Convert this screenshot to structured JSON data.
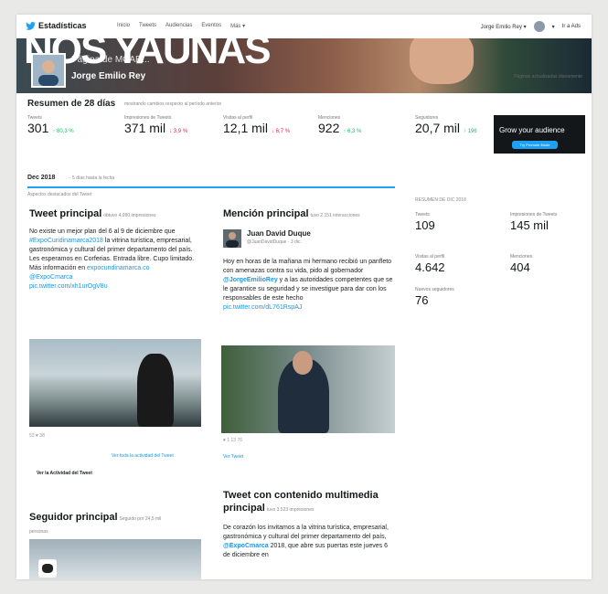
{
  "nav": {
    "brand": "Estadísticas",
    "links": [
      "Inicio",
      "Tweets",
      "Audiencias",
      "Eventos",
      "Más ▾"
    ],
    "account": "Jorge Emilio Rey ▾",
    "ads": "Ir a Ads"
  },
  "banner": {
    "big_text": "NOS YAUNAS",
    "overlay_text": "Página de MCAR...",
    "name": "Jorge Emilio Rey",
    "handle": "@JorgeEmilioRey",
    "right_note": "Páginas actualizadas diariamente"
  },
  "summary": {
    "title": "Resumen de 28 días",
    "subtitle": "mostrando cambios respecto al período anterior",
    "metrics": [
      {
        "label": "Tweets",
        "value": "301",
        "change": "↑ 80,3 %",
        "dir": "up"
      },
      {
        "label": "Impresiones de Tweets",
        "value": "371 mil",
        "change": "↓ 3,9 %",
        "dir": "down"
      },
      {
        "label": "Visitas al perfil",
        "value": "12,1 mil",
        "change": "↓ 6,7 %",
        "dir": "down"
      },
      {
        "label": "Menciones",
        "value": "922",
        "change": "↑ 6,3 %",
        "dir": "up"
      },
      {
        "label": "Seguidores",
        "value": "20,7 mil",
        "change": "↑ 196",
        "dir": "up"
      }
    ],
    "promo_title": "Grow your audience",
    "promo_button": "Try Promote Mode"
  },
  "month": {
    "label": "Dec 2018",
    "subtitle": "· 5 días hasta la fecha",
    "note": "Aspectos destacados del Tweet"
  },
  "top_tweet": {
    "title": "Tweet principal",
    "sub": "obtuvo 4.990 impresiones",
    "text_1": "No existe un mejor plan del 6 al 9 de diciembre que ",
    "hashtag": "#ExpoCundinamarca2018",
    "text_2": " la vitrina turística, empresarial, gastronómica y cultural del primer departamento del país. Les esperamos en Corferias. Entrada libre. Cupo limitado. Más información en ",
    "url_1": "expocundinamarca.co",
    "mention": "@ExpoCmarca",
    "pic": "pic.twitter.com/xh1urOgV8u",
    "stats": "53  ♥ 38",
    "view_activity": "Ver toda la actividad del Tweet",
    "view_label": "Ver la Actividad del Tweet"
  },
  "top_mention": {
    "title": "Mención principal",
    "sub": "tuvo 2.151 interacciones",
    "user": "Juan David Duque",
    "user_handle": "@JuanDavidDuque · 3 dic.",
    "text_1": "Hoy en horas de la mañana mi hermano recibió un panfleto con amenazas contra su vida, pido al gobernador ",
    "mention_1": "@JorgeEmilioRey",
    "text_2": " y a las autoridades competentes que se le garantice su seguridad y se investigue para dar con los responsables de este hecho ",
    "pic": "pic.twitter.com/dL761RspAJ",
    "stats": "♥ 1  13  76",
    "view": "Ver Tweet"
  },
  "media_tweet": {
    "title": "Tweet con contenido multimedia principal",
    "sub": "tuvo 3.523 impresiones",
    "text_1": "De corazón los invitamos a la vitrina turística, empresarial, gastronómica y cultural del primer departamento del país, ",
    "mention": "@ExpoCmarca",
    "text_2": " 2018, que abre sus puertas este jueves 6 de diciembre en"
  },
  "top_follower": {
    "title": "Seguidor principal",
    "sub": "Seguido por 24,5 mil",
    "sub2": "personas"
  },
  "month_stats": {
    "header": "RESUMEN DE DIC 2018",
    "items": [
      {
        "label": "Tweets",
        "value": "109"
      },
      {
        "label": "Impresiones de Tweets",
        "value": "145 mil"
      },
      {
        "label": "Visitas al perfil",
        "value": "4.642"
      },
      {
        "label": "Menciones",
        "value": "404"
      },
      {
        "label": "Nuevos seguidores",
        "value": "76"
      }
    ]
  }
}
